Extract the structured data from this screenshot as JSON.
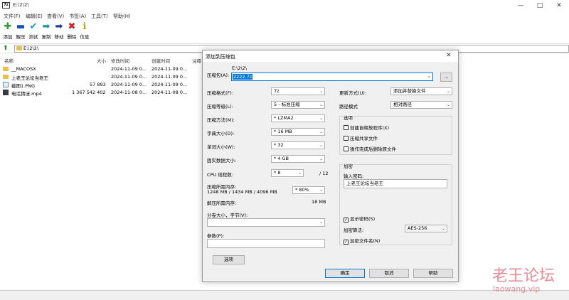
{
  "window": {
    "icon_text": "7z",
    "title": "E:\\2\\2\\",
    "minimize": "—",
    "maximize": "□",
    "close": "✕"
  },
  "menu": [
    "文件(F)",
    "编辑(E)",
    "查看(V)",
    "书签(A)",
    "工具(T)",
    "帮助(H)"
  ],
  "toolbar": [
    {
      "icon": "plus-icon",
      "glyph": "✚",
      "color": "#2aa02a",
      "label": "添加"
    },
    {
      "icon": "minus-icon",
      "glyph": "▬",
      "color": "#1a4fb5",
      "label": "解压"
    },
    {
      "icon": "check-icon",
      "glyph": "✔",
      "color": "#1aa0b0",
      "label": "测试"
    },
    {
      "icon": "arrow-right-icon",
      "glyph": "➡",
      "color": "#1a9a90",
      "label": "复制"
    },
    {
      "icon": "arrow-right-icon",
      "glyph": "➡",
      "color": "#1a3fa5",
      "label": "移动"
    },
    {
      "icon": "delete-icon",
      "glyph": "✖",
      "color": "#d02020",
      "label": "删除"
    },
    {
      "icon": "info-icon",
      "glyph": "ℹ",
      "color": "#c8a000",
      "label": "信息"
    }
  ],
  "path": "E:\\2\\2\\",
  "columns": {
    "name": "名称",
    "size": "大小",
    "modified": "修改时间",
    "created": "创建时间",
    "attr": "注释"
  },
  "files": [
    {
      "type": "folder",
      "name": "__MACOSX",
      "size": "",
      "modified": "2024-11-09 0...",
      "created": "2024-11-09 0..."
    },
    {
      "type": "folder",
      "name": "上老王论坛当老王",
      "size": "",
      "modified": "2024-11-09 0...",
      "created": "2024-11-09 0..."
    },
    {
      "type": "image",
      "name": "截图1.PNG",
      "size": "57 893",
      "modified": "2024-11-09 0...",
      "created": "2024-11-09 0..."
    },
    {
      "type": "video",
      "name": "电话猜谜.mp4",
      "size": "1 367 542 402",
      "modified": "2024-11-08 0...",
      "created": "2024-11-08 0..."
    }
  ],
  "dialog": {
    "title": "添加到压缩包",
    "close": "✕",
    "archive_label": "压缩包(A):",
    "archive_path": "E:\\2\\2\\",
    "archive_name": "2222.7z",
    "browse": "...",
    "format_label": "压缩格式(F):",
    "format_value": "7z",
    "level_label": "压缩等级(L):",
    "level_value": "5 - 标准压缩",
    "method_label": "压缩方法(M):",
    "method_value": "* LZMA2",
    "dict_label": "字典大小(D):",
    "dict_value": "* 16 MB",
    "word_label": "单词大小(W):",
    "word_value": "* 32",
    "solid_label": "固实数据大小:",
    "solid_value": "* 4 GB",
    "threads_label": "CPU 线程数:",
    "threads_value": "* 8",
    "threads_max": "/ 12",
    "mem_label": "压缩所需内存:",
    "mem_values": "1248 MB / 1434 MB / 4096 MB",
    "mem_percent": "* 80%",
    "decomp_label": "解压所需内存:",
    "decomp_value": "18 MB",
    "split_label": "分卷大小，字节(V):",
    "split_value": "",
    "params_label": "参数(P):",
    "params_value": "",
    "options_btn": "选项",
    "update_label": "更新方式(U):",
    "update_value": "添加并替换文件",
    "pathmode_label": "路径模式",
    "pathmode_value": "相对路径",
    "options_group": "选项",
    "opt_sfx": "创建自释放程序(X)",
    "opt_shared": "压缩共享文件",
    "opt_delete": "操作完成后删除原文件",
    "enc_group": "加密",
    "password_label": "输入密码:",
    "password_value": "上老王论坛当老王",
    "show_password": "显示密码(S)",
    "enc_method_label": "加密算法:",
    "enc_method_value": "AES-256",
    "enc_names": "加密文件名(N)",
    "ok": "确定",
    "cancel": "取消",
    "help": "帮助"
  },
  "watermark": {
    "line1": "老王论坛",
    "line2": "laowang.vip"
  }
}
